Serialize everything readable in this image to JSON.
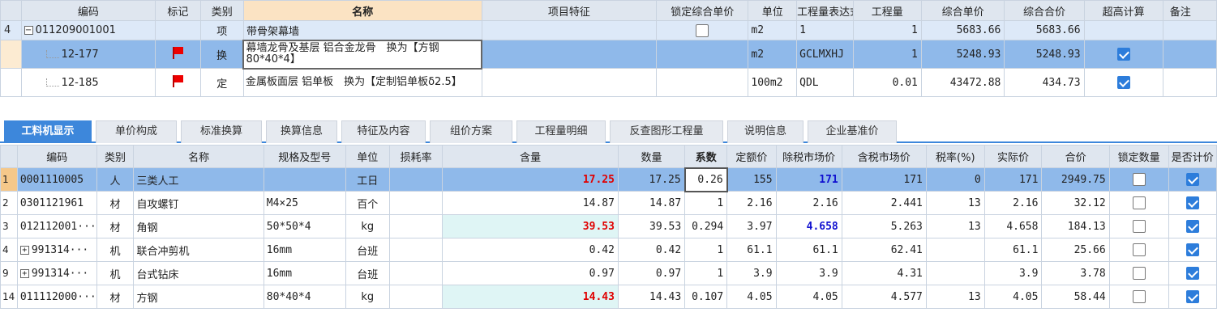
{
  "top_grid": {
    "headers": [
      "编码",
      "标记",
      "类别",
      "名称",
      "项目特征",
      "锁定综合单价",
      "单位",
      "工程量表达式",
      "工程量",
      "综合单价",
      "综合合价",
      "超高计算",
      "备注"
    ],
    "rows": [
      {
        "rowno": "4",
        "toggle": "−",
        "code": "011209001001",
        "mark": "",
        "type": "项",
        "name": "带骨架幕墙",
        "feature": "",
        "unit": "m2",
        "expr": "1",
        "qty": "1",
        "unit_price": "5683.66",
        "total": "5683.66"
      },
      {
        "rowno": "",
        "code": "12-177",
        "mark": "flag",
        "type": "换",
        "name": "幕墙龙骨及基层 铝合金龙骨　换为【方钢80*40*4】",
        "feature": "",
        "unit": "m2",
        "expr": "GCLMXHJ",
        "qty": "1",
        "unit_price": "5248.93",
        "total": "5248.93"
      },
      {
        "rowno": "",
        "code": "12-185",
        "mark": "flag",
        "type": "定",
        "name": "金属板面层 铝单板　换为【定制铝单板δ2.5】",
        "feature": "",
        "unit": "100m2",
        "expr": "QDL",
        "qty": "0.01",
        "unit_price": "43472.88",
        "total": "434.73"
      }
    ]
  },
  "tabs": [
    "工料机显示",
    "单价构成",
    "标准换算",
    "换算信息",
    "特征及内容",
    "组价方案",
    "工程量明细",
    "反查图形工程量",
    "说明信息",
    "企业基准价"
  ],
  "bottom_grid": {
    "headers": [
      "编码",
      "类别",
      "名称",
      "规格及型号",
      "单位",
      "损耗率",
      "含量",
      "数量",
      "系数",
      "定额价",
      "除税市场价",
      "含税市场价",
      "税率(%)",
      "实际价",
      "合价",
      "锁定数量",
      "是否计价"
    ],
    "rows": [
      {
        "rowno": "1",
        "code": "0001110005",
        "type": "人",
        "name": "三类人工",
        "spec": "",
        "unit": "工日",
        "loss": "",
        "content": "17.25",
        "qty": "17.25",
        "coef": "0.26",
        "quota": "155",
        "ex_tax": "171",
        "inc_tax": "171",
        "tax": "0",
        "actual": "171",
        "total": "2949.75"
      },
      {
        "rowno": "2",
        "code": "0301121961",
        "type": "材",
        "name": "自攻螺钉",
        "spec": "M4×25",
        "unit": "百个",
        "loss": "",
        "content": "14.87",
        "qty": "14.87",
        "coef": "1",
        "quota": "2.16",
        "ex_tax": "2.16",
        "inc_tax": "2.441",
        "tax": "13",
        "actual": "2.16",
        "total": "32.12"
      },
      {
        "rowno": "3",
        "code": "012112001···",
        "type": "材",
        "name": "角钢",
        "spec": "50*50*4",
        "unit": "kg",
        "loss": "",
        "content": "39.53",
        "qty": "39.53",
        "coef": "0.294",
        "quota": "3.97",
        "ex_tax": "4.658",
        "inc_tax": "5.263",
        "tax": "13",
        "actual": "4.658",
        "total": "184.13"
      },
      {
        "rowno": "4",
        "toggle": "+",
        "code": "991314···",
        "type": "机",
        "name": "联合冲剪机",
        "spec": "16mm",
        "unit": "台班",
        "loss": "",
        "content": "0.42",
        "qty": "0.42",
        "coef": "1",
        "quota": "61.1",
        "ex_tax": "61.1",
        "inc_tax": "62.41",
        "tax": "",
        "actual": "61.1",
        "total": "25.66"
      },
      {
        "rowno": "9",
        "toggle": "+",
        "code": "991314···",
        "type": "机",
        "name": "台式钻床",
        "spec": "16mm",
        "unit": "台班",
        "loss": "",
        "content": "0.97",
        "qty": "0.97",
        "coef": "1",
        "quota": "3.9",
        "ex_tax": "3.9",
        "inc_tax": "4.31",
        "tax": "",
        "actual": "3.9",
        "total": "3.78"
      },
      {
        "rowno": "14",
        "code": "011112000···",
        "type": "材",
        "name": "方钢",
        "spec": "80*40*4",
        "unit": "kg",
        "loss": "",
        "content": "14.43",
        "qty": "14.43",
        "coef": "0.107",
        "quota": "4.05",
        "ex_tax": "4.05",
        "inc_tax": "4.577",
        "tax": "13",
        "actual": "4.05",
        "total": "58.44"
      }
    ]
  }
}
